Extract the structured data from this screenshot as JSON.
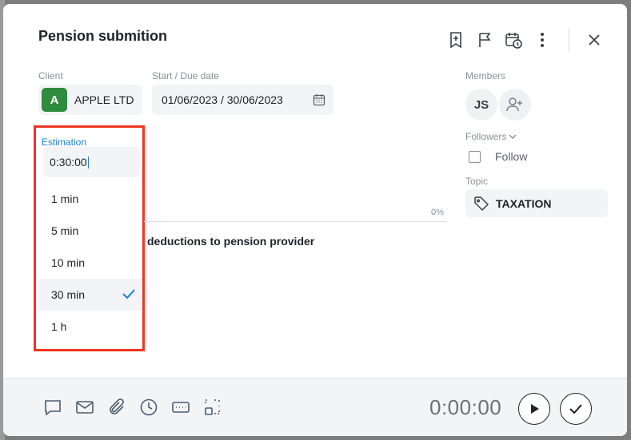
{
  "modal": {
    "title": "Pension submition"
  },
  "fields": {
    "client_label": "Client",
    "client_initial": "A",
    "client_name": "APPLE LTD",
    "date_label": "Start / Due date",
    "date_value": "01/06/2023 / 30/06/2023",
    "estimation_label": "Estimation",
    "estimation_value": "0:30:00"
  },
  "estimation_options": [
    {
      "label": "1 min",
      "selected": false
    },
    {
      "label": "5 min",
      "selected": false
    },
    {
      "label": "10 min",
      "selected": false
    },
    {
      "label": "30 min",
      "selected": true
    },
    {
      "label": "1 h",
      "selected": false
    }
  ],
  "progress": {
    "percent_label": "0%",
    "value": 0
  },
  "task": {
    "partial_text": "deductions to pension provider"
  },
  "sidebar": {
    "members_label": "Members",
    "member_initials": "JS",
    "followers_label": "Followers",
    "follow_label": "Follow",
    "topic_label": "Topic",
    "topic_value": "TAXATION"
  },
  "footer": {
    "timer": "0:00:00"
  },
  "colors": {
    "accent": "#1d7fd1",
    "client_avatar": "#2f8b3d",
    "highlight": "#f03421"
  },
  "icons": {
    "top": [
      "bookmark-add-icon",
      "flag-icon",
      "calendar-clock-icon",
      "more-vertical-icon",
      "close-icon"
    ],
    "footer": [
      "comment-icon",
      "mail-icon",
      "attachment-icon",
      "clock-icon",
      "keyboard-icon",
      "scan-icon"
    ]
  }
}
